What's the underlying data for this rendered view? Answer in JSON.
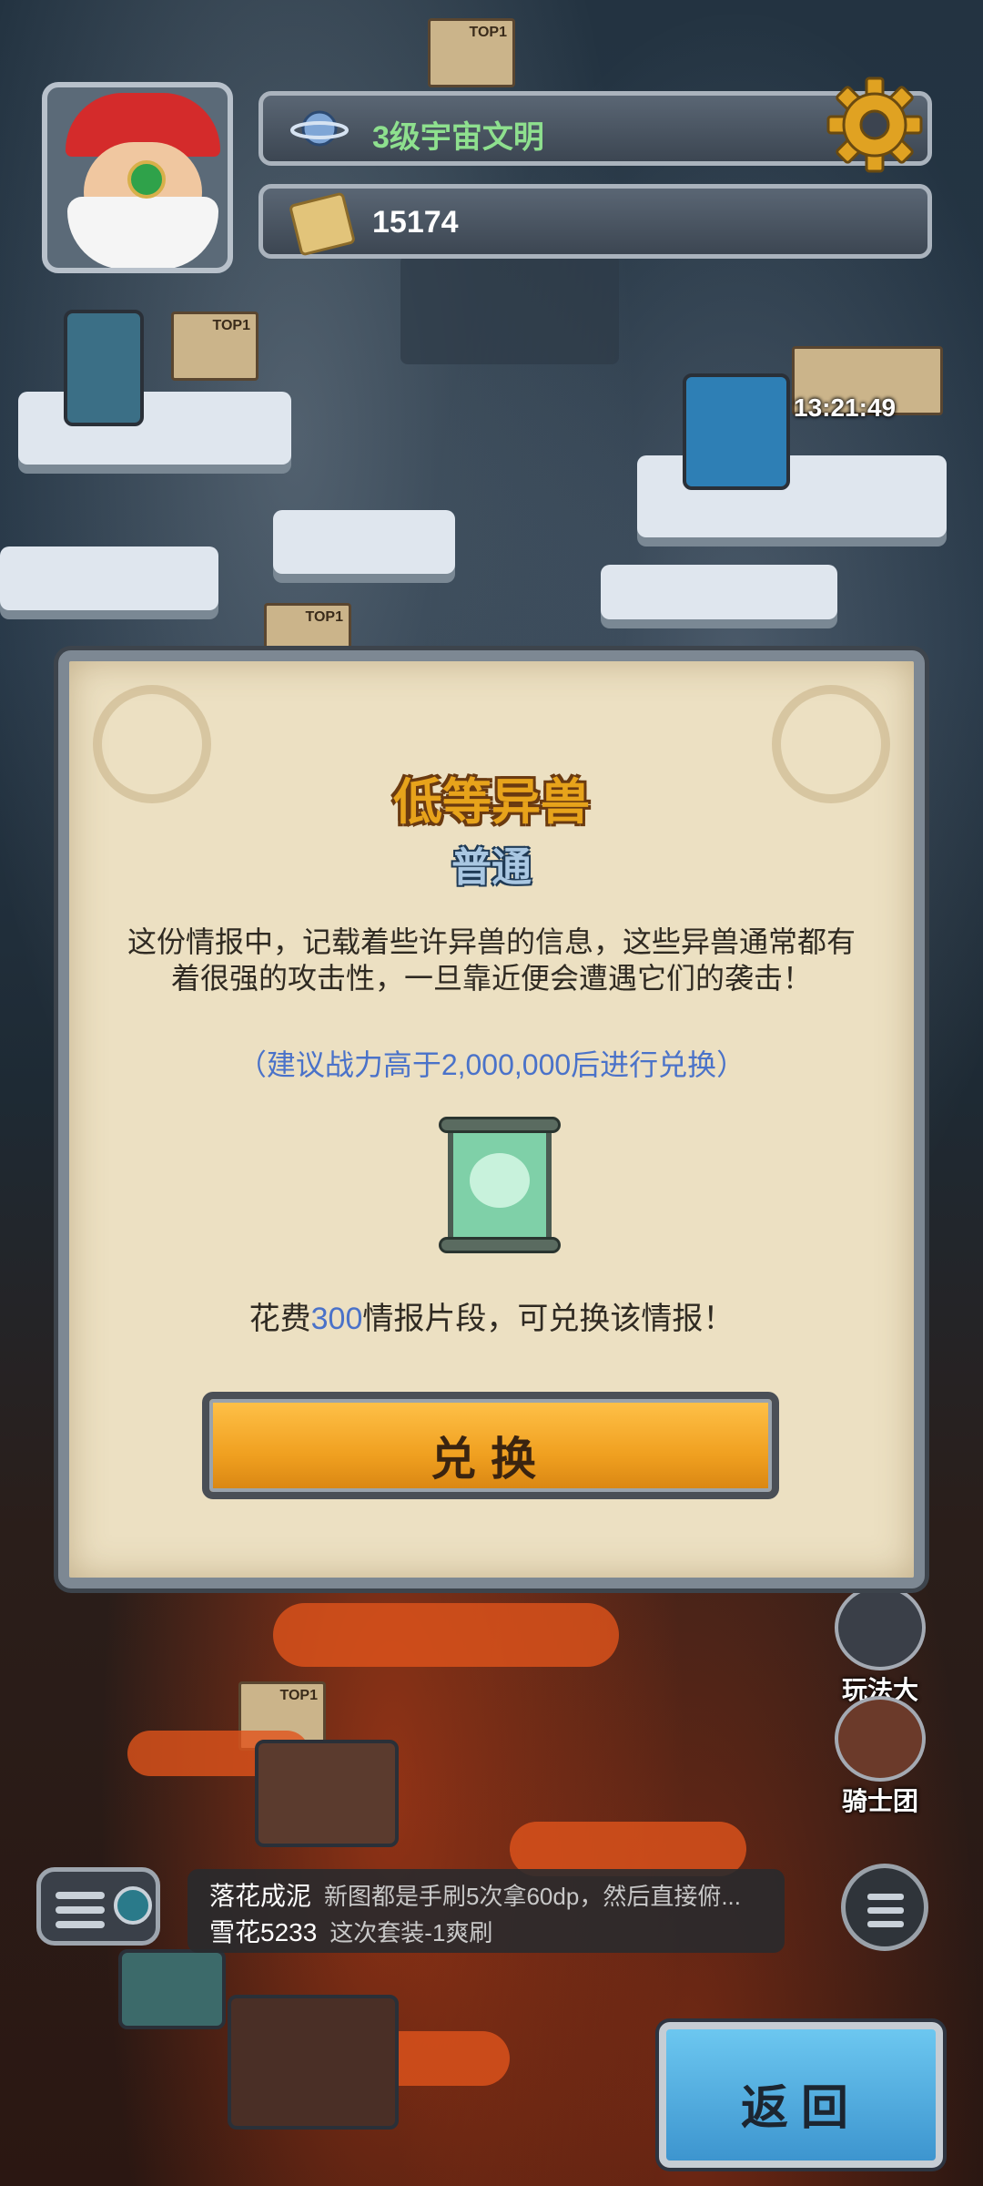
{
  "status_bar": {
    "civilization_level": "3级宇宙文明",
    "currency_amount": "15174"
  },
  "map": {
    "top_badge": "TOP1",
    "timer": "13:21:49"
  },
  "dialog": {
    "title": "低等异兽",
    "subtitle": "普通",
    "description": "这份情报中，记载着些许异兽的信息，这些异兽通常都有着很强的攻击性，一旦靠近便会遭遇它们的袭击！",
    "recommendation": "（建议战力高于2,000,000后进行兑换）",
    "cost_prefix": "花费",
    "cost_amount": "300",
    "cost_suffix": "情报片段，可兑换该情报！",
    "exchange_label": "兑换"
  },
  "side_menu": {
    "play_hall": "玩法大厅",
    "knights": "骑士团"
  },
  "chat": {
    "messages": [
      {
        "name": "落花成泥",
        "text": "新图都是手刷5次拿60dp，然后直接俯..."
      },
      {
        "name": "雪花5233",
        "text": "这次套装-1爽刷"
      }
    ]
  },
  "back_label": "返回",
  "colors": {
    "title": "#e7a31b",
    "hint": "#4a72c9",
    "exchange_button": "#f0a020",
    "back_button": "#3d95cf"
  },
  "icons": [
    "planet-icon",
    "scroll-icon",
    "gear-icon",
    "gamepad-icon",
    "trophy-icon",
    "chat-icon",
    "menu-icon",
    "beast-scroll-icon"
  ]
}
